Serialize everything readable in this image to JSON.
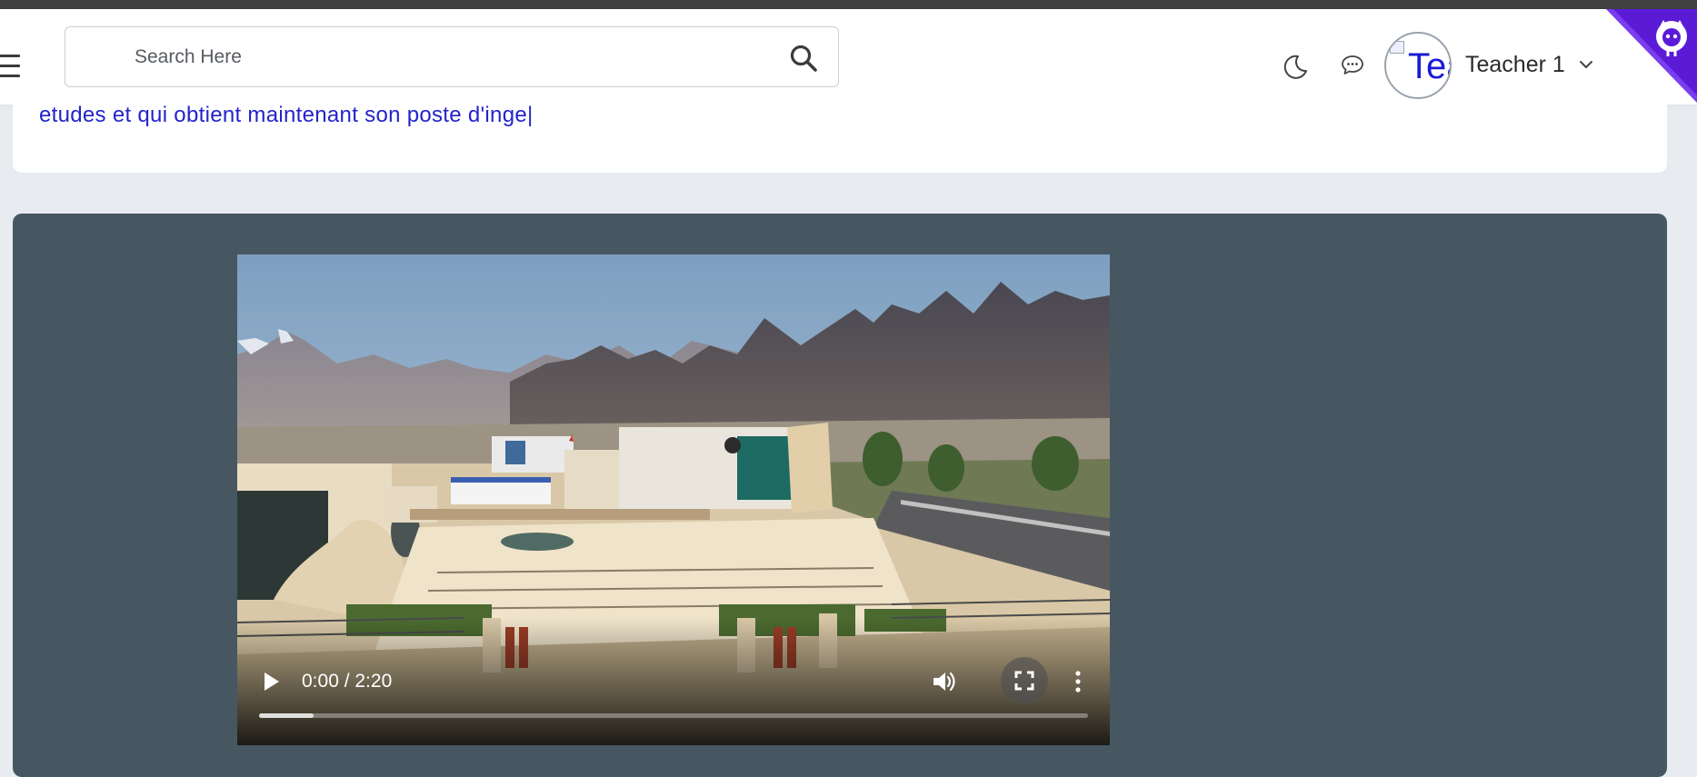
{
  "header": {
    "search": {
      "placeholder": "Search Here",
      "value": ""
    },
    "user": {
      "name": "Teacher 1",
      "avatar_alt": "Teacher 1"
    },
    "icons": [
      "menu-icon",
      "search-icon",
      "moon-icon",
      "chat-icon",
      "chevron-down-icon",
      "github-icon"
    ]
  },
  "content": {
    "text_line": "etudes et qui obtient maintenant son poste d'inge|"
  },
  "video": {
    "time_display": "0:00 / 2:20",
    "current_time": "0:00",
    "duration": "2:20",
    "buffered_fraction": 0.066
  },
  "colors": {
    "video_card_bg": "#465762",
    "text_link": "#2323cc",
    "github_corner": "#5b1bd6",
    "page_bg": "#e8ebf0"
  }
}
